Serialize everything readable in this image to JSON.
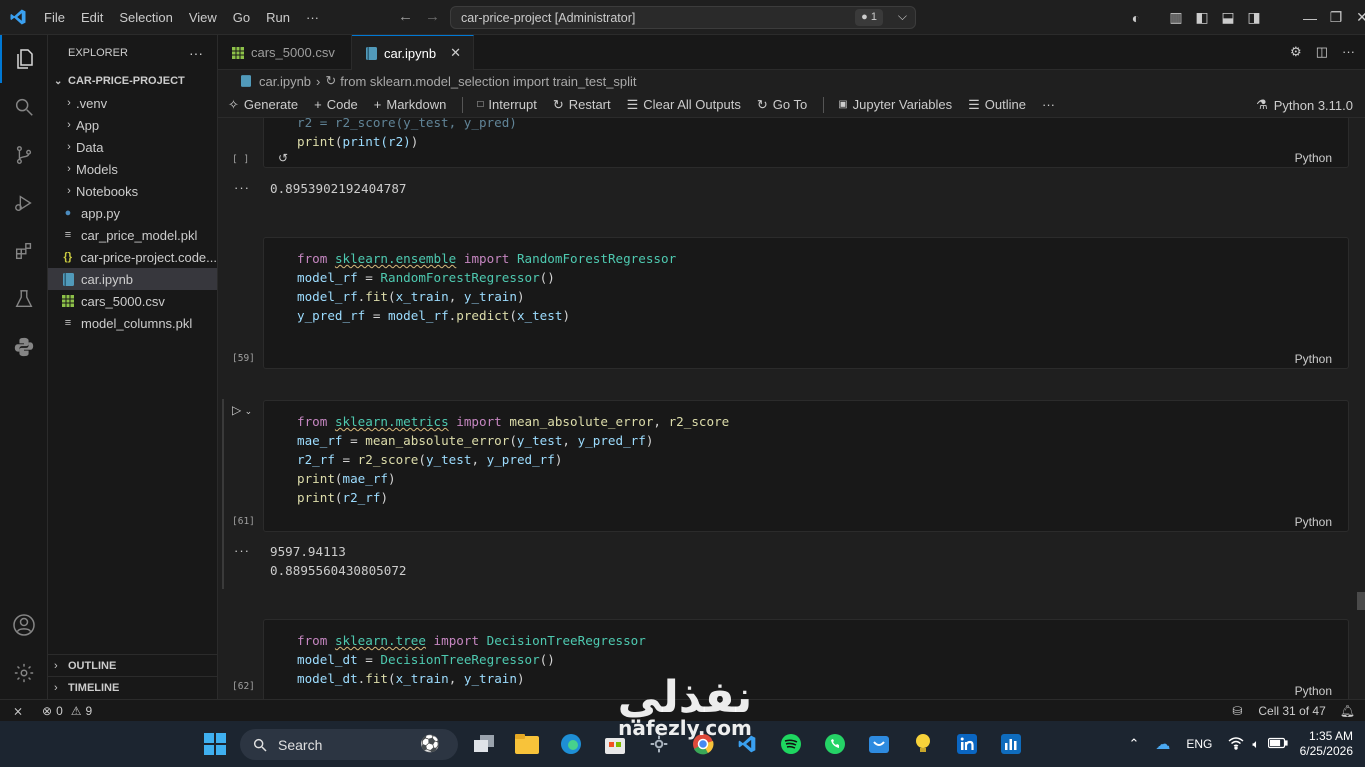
{
  "title_bar": {
    "menu": [
      "File",
      "Edit",
      "Selection",
      "View",
      "Go",
      "Run",
      "···"
    ],
    "command_center": "car-price-project [Administrator]",
    "notification_count": "1"
  },
  "sidebar": {
    "header": "EXPLORER",
    "project": "CAR-PRICE-PROJECT",
    "items": [
      {
        "label": ".venv",
        "type": "folder"
      },
      {
        "label": "App",
        "type": "folder"
      },
      {
        "label": "Data",
        "type": "folder"
      },
      {
        "label": "Models",
        "type": "folder"
      },
      {
        "label": "Notebooks",
        "type": "folder"
      },
      {
        "label": "app.py",
        "type": "python"
      },
      {
        "label": "car_price_model.pkl",
        "type": "pkl"
      },
      {
        "label": "car-price-project.code...",
        "type": "json"
      },
      {
        "label": "car.ipynb",
        "type": "notebook"
      },
      {
        "label": "cars_5000.csv",
        "type": "csv"
      },
      {
        "label": "model_columns.pkl",
        "type": "pkl"
      }
    ],
    "outline": "OUTLINE",
    "timeline": "TIMELINE"
  },
  "tabs": [
    {
      "label": "cars_5000.csv",
      "active": false
    },
    {
      "label": "car.ipynb",
      "active": true
    }
  ],
  "breadcrumb": {
    "file": "car.ipynb",
    "symbol": "from sklearn.model_selection import train_test_split"
  },
  "toolbar": {
    "generate": "Generate",
    "code": "Code",
    "markdown": "Markdown",
    "interrupt": "Interrupt",
    "restart": "Restart",
    "clear": "Clear All Outputs",
    "goto": "Go To",
    "variables": "Jupyter Variables",
    "outline": "Outline",
    "more": "···",
    "kernel": "Python 3.11.0"
  },
  "cells": {
    "c0": {
      "exec": "[ ]",
      "lang": "Python",
      "line_print": "print(r2)",
      "output": "0.8953902192404787"
    },
    "c1": {
      "exec": "[59]",
      "lang": "Python"
    },
    "c2": {
      "exec": "[61]",
      "lang": "Python",
      "output1": "9597.94113",
      "output2": "0.8895560430805072"
    },
    "c3": {
      "exec": "[62]",
      "lang": "Python"
    }
  },
  "status_bar": {
    "errors": "0",
    "warnings": "9",
    "cell": "Cell 31 of 47"
  },
  "taskbar": {
    "search": "Search",
    "lang": "ENG",
    "time": "1:35 AM",
    "date": "6/25/2026"
  },
  "watermark": {
    "arabic": "نفذلي",
    "latin": "nafezly.com"
  }
}
